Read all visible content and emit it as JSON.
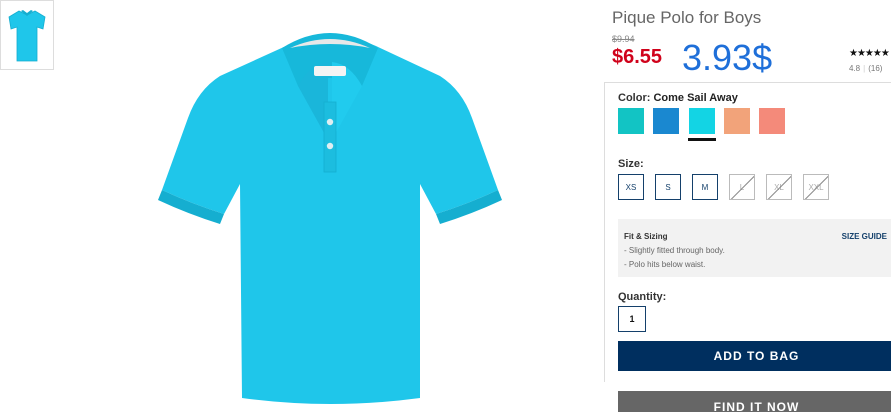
{
  "product": {
    "title": "Pique Polo for Boys",
    "old_price": "$9.94",
    "sale_price": "$6.55",
    "annotated_price": "3.93$",
    "stars": "★★★★★",
    "rating": "4.8",
    "review_count": "(16)"
  },
  "color": {
    "label": "Color:",
    "value": "Come Sail Away",
    "selected_index": 2,
    "swatches": [
      "#12c4c4",
      "#1a88d0",
      "#13d4e4",
      "#f2a37a",
      "#f48a7a"
    ]
  },
  "size": {
    "label": "Size:",
    "options": [
      {
        "label": "XS",
        "available": true
      },
      {
        "label": "S",
        "available": true
      },
      {
        "label": "M",
        "available": true
      },
      {
        "label": "L",
        "available": false
      },
      {
        "label": "XL",
        "available": false
      },
      {
        "label": "XXL",
        "available": false
      }
    ]
  },
  "fit": {
    "title": "Fit & Sizing",
    "guide_link": "SIZE GUIDE",
    "lines": [
      "- Slightly fitted through body.",
      "- Polo hits below waist."
    ]
  },
  "quantity": {
    "label": "Quantity:",
    "value": "1"
  },
  "actions": {
    "add_to_bag": "ADD TO BAG",
    "find_it_now": "FIND IT NOW"
  },
  "colors": {
    "shirt": "#1fc6ea",
    "shirt_shadow": "#15aed0",
    "sale_red": "#d0021b",
    "navy": "#002f5f",
    "annotation_blue": "#1e6fd9"
  }
}
